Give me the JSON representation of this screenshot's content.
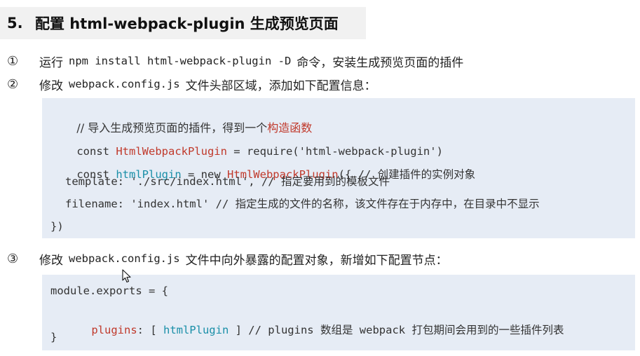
{
  "section": {
    "number": "5.",
    "title": "配置 html-webpack-plugin 生成预览页面"
  },
  "steps": [
    {
      "marker": "①",
      "text_before": "运行",
      "code": "npm install html-webpack-plugin -D",
      "text_after": "命令，安装生成预览页面的插件"
    },
    {
      "marker": "②",
      "text_before": "修改",
      "code": "webpack.config.js",
      "text_after": "文件头部区域，添加如下配置信息："
    },
    {
      "marker": "③",
      "text_before": "修改",
      "code": "webpack.config.js",
      "text_after": "文件中向外暴露的配置对象，新增如下配置节点："
    }
  ],
  "code_block_1": {
    "line1_comment": "// 导入生成预览页面的插件，得到一个",
    "line1_highlight": "构造函数",
    "line2_kw": "const ",
    "line2_name": "HtmlWebpackPlugin",
    "line2_rest": " = require('html-webpack-plugin')",
    "line3_kw": "const ",
    "line3_name": "htmlPlugin",
    "line3_mid": " = new ",
    "line3_ctor": "HtmlWebpackPlugin",
    "line3_rest": "({ // 创建插件的实例对象",
    "line4": "template: './src/index.html', // 指定要用到的模板文件",
    "line5": "filename: 'index.html' // 指定生成的文件的名称，该文件存在于内存中，在目录中不显示",
    "line6": "})"
  },
  "code_block_2": {
    "line1": "module.exports = {",
    "line2_key": "plugins",
    "line2_mid": ": [ ",
    "line2_val": "htmlPlugin",
    "line2_rest": " ] // plugins 数组是 webpack 打包期间会用到的一些插件列表",
    "line3": "}"
  },
  "colors": {
    "highlight_red": "#c0392b",
    "highlight_teal": "#1a8fa8",
    "code_bg": "#e6ecf5"
  },
  "icons": {
    "mouse_cursor": "arrow-cursor-icon"
  }
}
